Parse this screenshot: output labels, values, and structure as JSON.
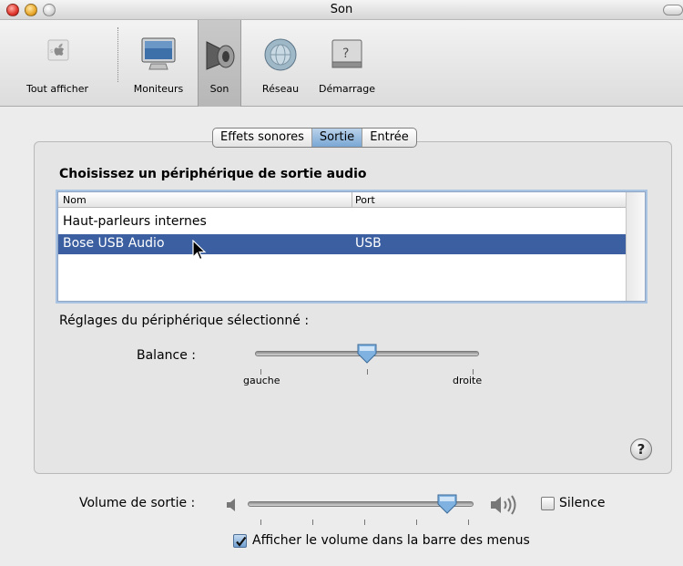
{
  "window": {
    "title": "Son"
  },
  "toolbar": {
    "items": [
      {
        "label": "Tout afficher",
        "icon": "apple-icon"
      },
      {
        "label": "Moniteurs",
        "icon": "monitor-icon"
      },
      {
        "label": "Son",
        "icon": "speaker-icon",
        "active": true
      },
      {
        "label": "Réseau",
        "icon": "globe-icon"
      },
      {
        "label": "Démarrage",
        "icon": "hard-drive-icon"
      }
    ]
  },
  "tabs": [
    {
      "label": "Effets sonores"
    },
    {
      "label": "Sortie",
      "selected": true
    },
    {
      "label": "Entrée"
    }
  ],
  "output": {
    "heading": "Choisissez un périphérique de sortie audio",
    "columns": [
      "Nom",
      "Port"
    ],
    "rows": [
      {
        "name": "Haut-parleurs internes",
        "port": ""
      },
      {
        "name": "Bose USB Audio",
        "port": "USB",
        "selected": true
      }
    ],
    "settings_heading": "Réglages du périphérique sélectionné :",
    "balance": {
      "label": "Balance :",
      "left": "gauche",
      "right": "droite",
      "value": 0.5
    }
  },
  "volume": {
    "label": "Volume de sortie :",
    "value": 0.9,
    "mute_label": "Silence",
    "mute_checked": false,
    "show_in_menu_label": "Afficher le volume dans la barre des menus",
    "show_in_menu_checked": true
  },
  "help": {
    "symbol": "?"
  },
  "colors": {
    "selection": "#3b5fa0",
    "tab_selected": "#79a7d4"
  }
}
